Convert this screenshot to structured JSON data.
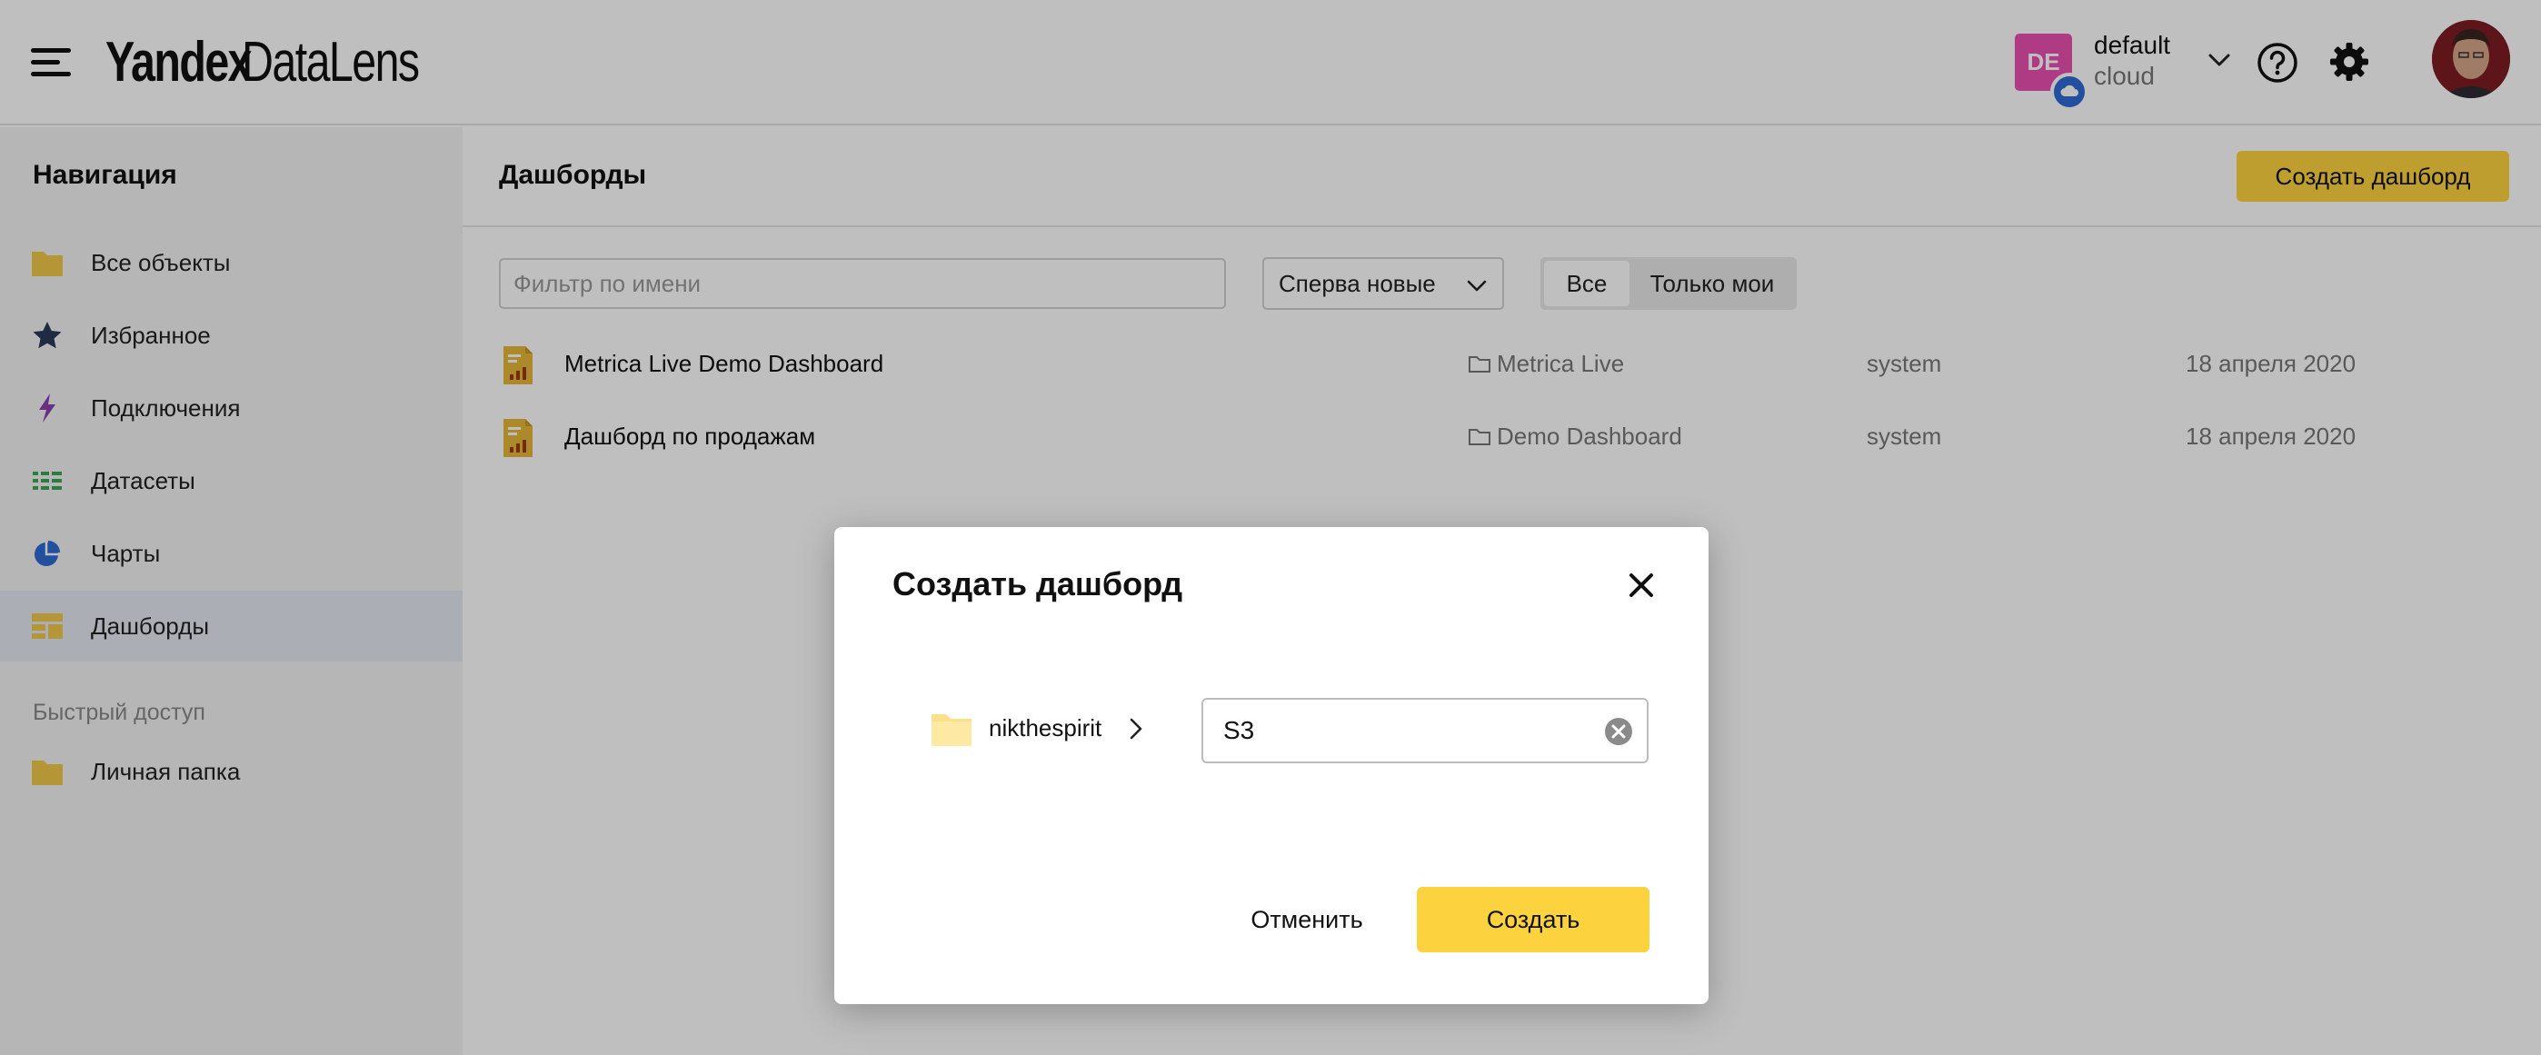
{
  "header": {
    "logo_bold": "Yandex",
    "logo_thin": "DataLens",
    "account": {
      "badge": "DE",
      "name": "default",
      "subtitle": "cloud"
    },
    "icons": [
      "menu-icon",
      "chevron-down-icon",
      "help-icon",
      "gear-icon",
      "avatar"
    ]
  },
  "sidebar": {
    "title": "Навигация",
    "items": [
      {
        "label": "Все объекты",
        "icon": "folder-icon"
      },
      {
        "label": "Избранное",
        "icon": "star-icon"
      },
      {
        "label": "Подключения",
        "icon": "lightning-icon"
      },
      {
        "label": "Датасеты",
        "icon": "dataset-icon"
      },
      {
        "label": "Чарты",
        "icon": "pie-chart-icon"
      },
      {
        "label": "Дашборды",
        "icon": "dashboard-icon",
        "active": true
      }
    ],
    "quick_access_title": "Быстрый доступ",
    "quick_access_items": [
      {
        "label": "Личная папка",
        "icon": "folder-icon"
      }
    ]
  },
  "main": {
    "title": "Дашборды",
    "create_button": "Создать дашборд",
    "filter_placeholder": "Фильтр по имени",
    "sort_value": "Сперва новые",
    "segments": [
      "Все",
      "Только мои"
    ],
    "rows": [
      {
        "name": "Metrica Live Demo Dashboard",
        "folder": "Metrica Live",
        "owner": "system",
        "date": "18 апреля 2020"
      },
      {
        "name": "Дашборд по продажам",
        "folder": "Demo Dashboard",
        "owner": "system",
        "date": "18 апреля 2020"
      }
    ]
  },
  "dialog": {
    "title": "Создать дашборд",
    "folder": "nikthespirit",
    "name_value": "S3",
    "cancel": "Отменить",
    "create": "Создать"
  },
  "colors": {
    "accent_yellow": "#fcd33e",
    "badge_pink": "#e94fb0",
    "cloud_blue": "#2f6ad5",
    "active_item_bg": "#e4e9f2"
  }
}
